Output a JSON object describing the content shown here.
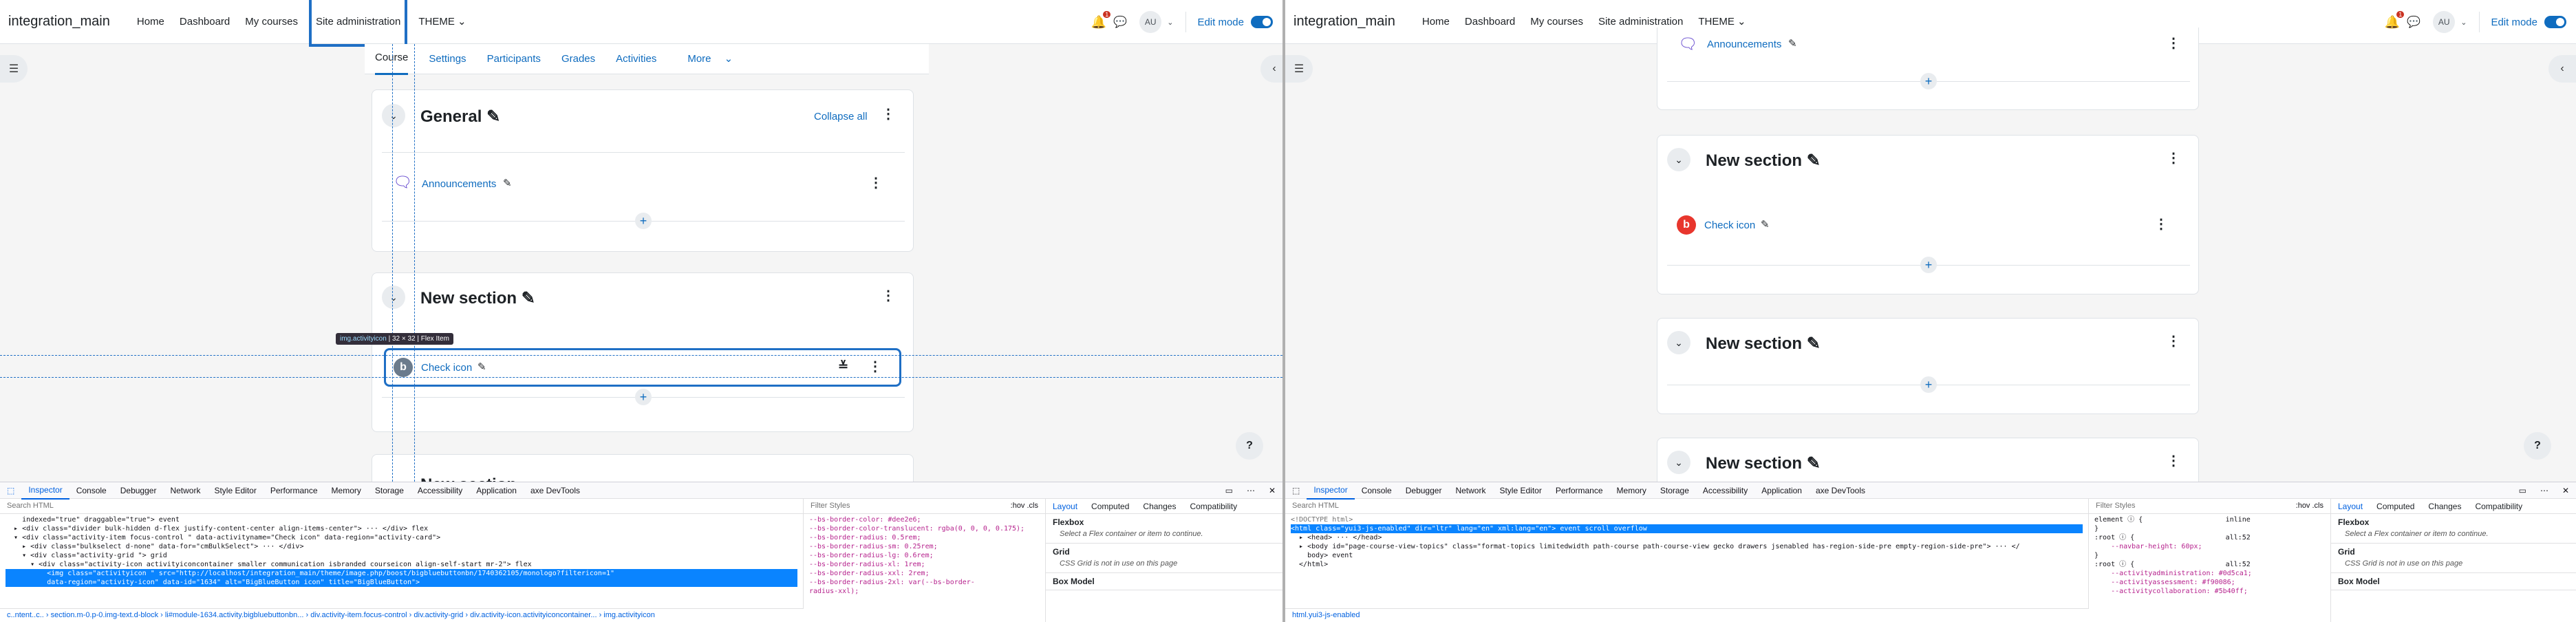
{
  "nav": {
    "site_name": "integration_main",
    "links": [
      "Home",
      "Dashboard",
      "My courses",
      "Site administration",
      "THEME"
    ],
    "notification_count": "1",
    "avatar_initials": "AU",
    "edit_mode_label": "Edit mode"
  },
  "course_tabs": [
    "Course",
    "Settings",
    "Participants",
    "Grades",
    "Activities",
    "More"
  ],
  "left": {
    "general_title": "General",
    "collapse_all": "Collapse all",
    "announcements": "Announcements",
    "new_section": "New section",
    "check_icon": "Check icon",
    "partial_section": "New section",
    "tooltip_tag": "img.activityicon",
    "tooltip_size": "32 × 32",
    "tooltip_type": "Flex Item"
  },
  "right": {
    "announcements": "Announcements",
    "sections": [
      {
        "title": "New section",
        "activity": "Check icon"
      },
      {
        "title": "New section",
        "activity": ""
      },
      {
        "title": "New section",
        "activity": ""
      }
    ]
  },
  "devtools": {
    "tabs": [
      "Inspector",
      "Console",
      "Debugger",
      "Network",
      "Style Editor",
      "Performance",
      "Memory",
      "Storage",
      "Accessibility",
      "Application",
      "axe DevTools"
    ],
    "search_html": "Search HTML",
    "filter_styles": "Filter Styles",
    "hov": ":hov",
    "cls": ".cls",
    "layout_tabs": [
      "Layout",
      "Computed",
      "Changes",
      "Compatibility"
    ],
    "flexbox": "Flexbox",
    "flexbox_desc": "Select a Flex container or item to continue.",
    "grid": "Grid",
    "grid_desc": "CSS Grid is not in use on this page",
    "box_model": "Box Model",
    "left_html": [
      "    indexed=\"true\" draggable=\"true\"> event",
      "  ▸ <div class=\"divider bulk-hidden d-flex justify-content-center align-items-center\"> ··· </div> flex",
      "  ▾ <div class=\"activity-item focus-control \" data-activityname=\"Check icon\" data-region=\"activity-card\">",
      "    ▸ <div class=\"bulkselect d-none\" data-for=\"cmBulkSelect\"> ··· </div>",
      "    ▾ <div class=\"activity-grid \"> grid",
      "      ▾ <div class=\"activity-icon activityiconcontainer smaller communication isbranded courseicon align-self-start mr-2\"> flex",
      "          <img class=\"activityicon \" src=\"http://localhost/integration_main/theme/image.php/boost/bigbluebuttonbn/1740362105/monologo?filtericon=1\"",
      "          data-region=\"activity-icon\" data-id=\"1634\" alt=\"BigBlueButton icon\" title=\"BigBlueButton\">"
    ],
    "left_css": [
      "--bs-border-color: #dee2e6;",
      "--bs-border-color-translucent: rgba(0, 0, 0, 0.175);",
      "--bs-border-radius: 0.5rem;",
      "--bs-border-radius-sm: 0.25rem;",
      "--bs-border-radius-lg: 0.6rem;",
      "--bs-border-radius-xl: 1rem;",
      "--bs-border-radius-xxl: 2rem;",
      "--bs-border-radius-2xl: var(--bs-border-",
      "radius-xxl);"
    ],
    "left_breadcrumb": "c..ntent..c.. › section.m-0.p-0.img-text.d-block › li#module-1634.activity.bigbluebuttonbn... › div.activity-item.focus-control › div.activity-grid › div.activity-icon.activityiconcontainer... › img.activityicon",
    "right_html": [
      "<!DOCTYPE html>",
      "<html class=\"yui3-js-enabled\" dir=\"ltr\" lang=\"en\" xml:lang=\"en\"> event scroll overflow",
      "  ▸ <head> ··· </head>",
      "  ▸ <body id=\"page-course-view-topics\" class=\"format-topics limitedwidth path-course path-course-view gecko drawers jsenabled has-region-side-pre empty-region-side-pre\"> ··· </",
      "    body> event",
      "  </html>"
    ],
    "right_css": [
      "element ⓘ {                    inline",
      "}",
      ":root ⓘ {                      all:52",
      "    --navbar-height: 60px;",
      "}",
      ":root ⓘ {                      all:52",
      "    --activityadministration: #0d5ca1;",
      "    --activityassessment: #f90086;",
      "    --activitycollaboration: #5b40ff;"
    ],
    "right_breadcrumb": "html.yui3-js-enabled"
  }
}
